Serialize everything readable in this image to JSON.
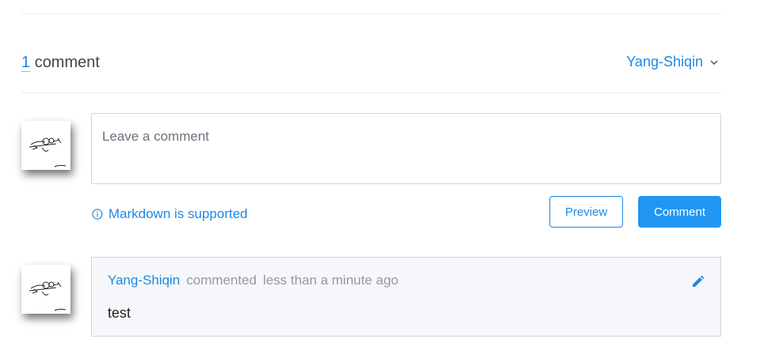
{
  "header": {
    "comment_count": "1",
    "comment_word": "comment",
    "username": "Yang-Shiqin"
  },
  "editor": {
    "placeholder": "Leave a comment",
    "markdown_note": "Markdown is supported",
    "preview_label": "Preview",
    "comment_label": "Comment"
  },
  "comments": [
    {
      "author": "Yang-Shiqin",
      "action": "commented",
      "time": "less than a minute ago",
      "body": "test"
    }
  ],
  "colors": {
    "accent": "#1e88e5",
    "button_primary": "#2196f3",
    "comment_bg": "#f5f7fa"
  },
  "icons": [
    "chevron-down-icon",
    "info-icon",
    "pencil-icon"
  ]
}
